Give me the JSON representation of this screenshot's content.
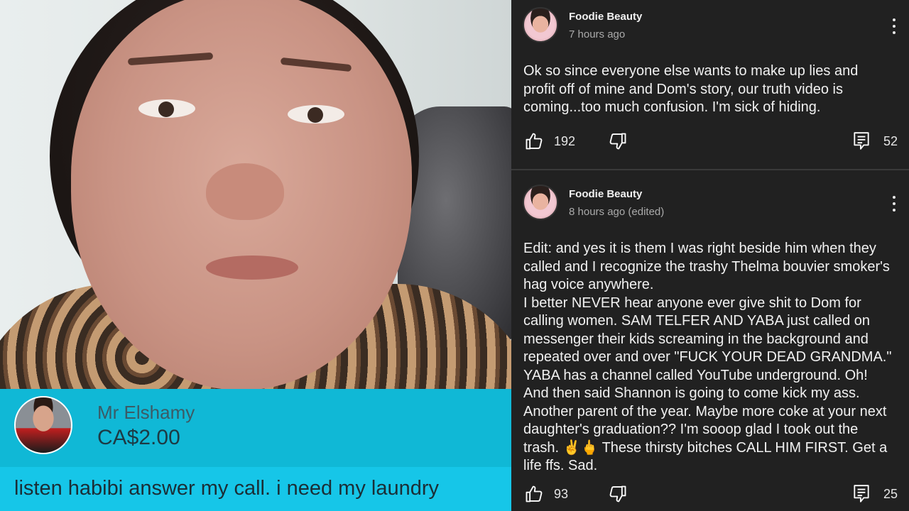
{
  "video": {
    "donation": {
      "donor_name": "Mr Elshamy",
      "amount": "CA$2.00",
      "message": "listen habibi answer my call. i need my laundry"
    }
  },
  "comments": [
    {
      "author": "Foodie Beauty",
      "time": "7 hours ago",
      "text": "Ok so since everyone else wants to make up lies and profit off of mine and Dom's story, our truth video is coming...too much confusion. I'm sick of hiding.",
      "likes": "192",
      "replies": "52"
    },
    {
      "author": "Foodie Beauty",
      "time": "8 hours ago (edited)",
      "text": "Edit: and yes it is them I was right beside him when they called and I recognize the trashy Thelma bouvier smoker's hag voice anywhere.\nI better NEVER hear anyone ever give shit to Dom for calling women. SAM TELFER AND YABA just called on messenger their kids screaming in the background and repeated over and over \"FUCK YOUR DEAD GRANDMA.\" YABA has a channel called YouTube underground. Oh! And then said Shannon is going to come kick my ass. Another parent of the year. Maybe more coke at your next daughter's graduation?? I'm sooop glad I took out the trash. ✌️🖕 These thirsty bitches CALL HIM FIRST. Get a life ffs. Sad.",
      "likes": "93",
      "replies": "25"
    }
  ],
  "icons": {
    "like": "thumbs-up-icon",
    "dislike": "thumbs-down-icon",
    "reply": "reply-icon",
    "menu": "more-vert-icon"
  },
  "colors": {
    "panel_bg": "#212121",
    "donation_bg": "#10b8d6",
    "message_bg": "#16c6e8"
  }
}
